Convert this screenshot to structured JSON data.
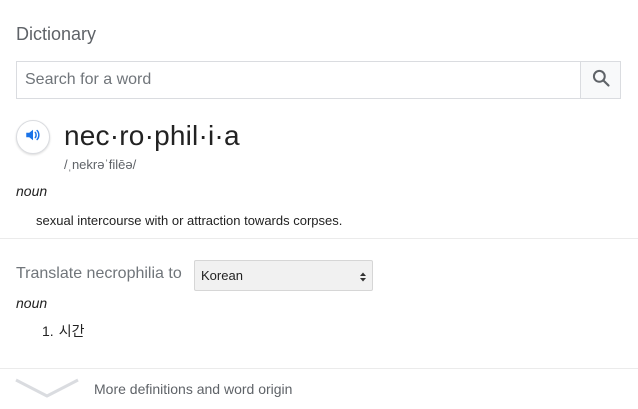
{
  "dictionary": {
    "title": "Dictionary",
    "search": {
      "placeholder": "Search for a word",
      "value": "",
      "button_icon": "search-icon"
    },
    "entry": {
      "speaker_icon": "speaker-icon",
      "headword": "nec·ro·phil·i·a",
      "pronunciation": "/ˌnekrəˈfilēə/",
      "part_of_speech": "noun",
      "definition": "sexual intercourse with or attraction towards corpses."
    },
    "translate": {
      "label": "Translate necrophilia to",
      "selected_language": "Korean",
      "part_of_speech": "noun",
      "items": [
        {
          "number": "1.",
          "text": "시간"
        }
      ]
    },
    "more": {
      "icon": "chevron-down-icon",
      "label": "More definitions and word origin"
    }
  },
  "colors": {
    "accent": "#1a73e8",
    "muted_text": "#70757a",
    "border": "#dadce0"
  }
}
